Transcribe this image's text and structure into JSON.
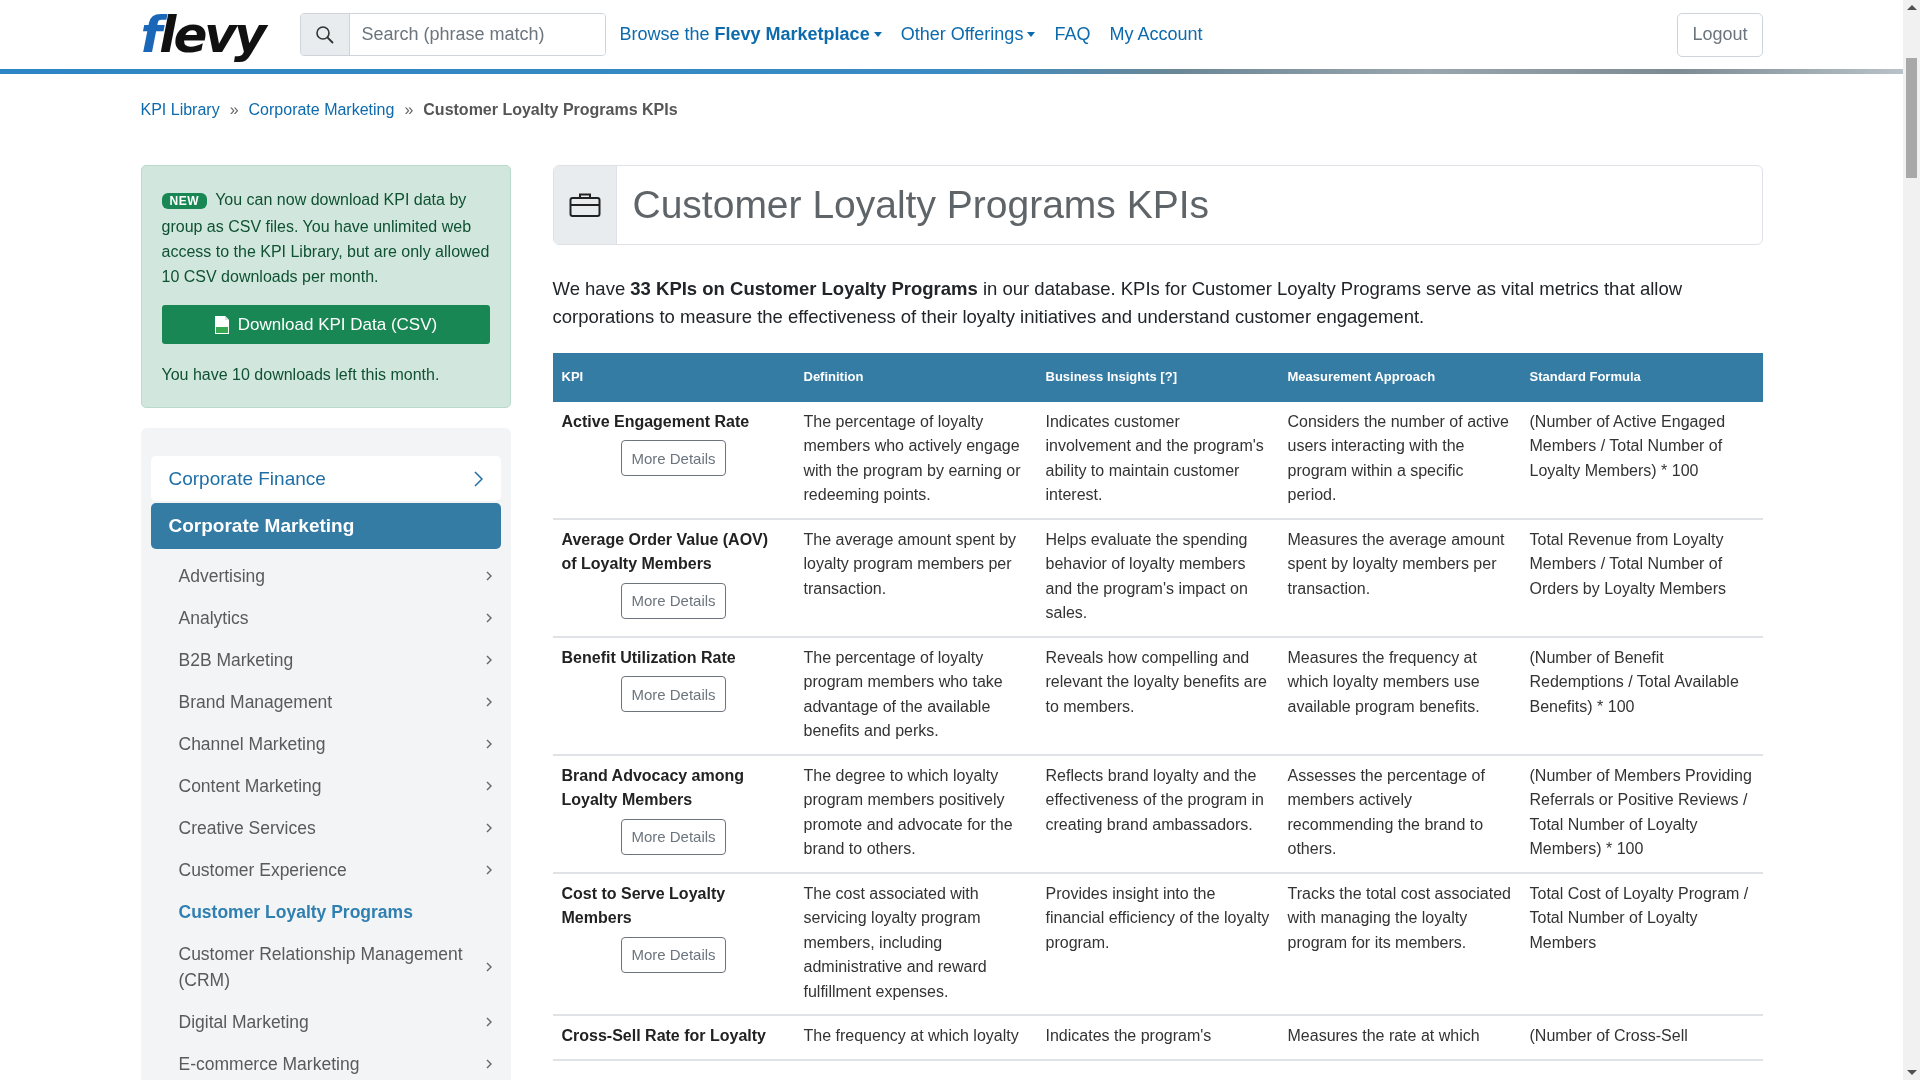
{
  "header": {
    "logo": "flevy",
    "search": {
      "placeholder": "Search (phrase match)"
    },
    "nav": [
      {
        "text": "Browse the **Flevy Marketplace**",
        "dropdown": true
      },
      {
        "text": "Other Offerings",
        "dropdown": true
      },
      {
        "text": "FAQ",
        "dropdown": false
      },
      {
        "text": "My Account",
        "dropdown": false
      }
    ],
    "logout": "Logout"
  },
  "breadcrumb": [
    {
      "label": "KPI Library",
      "current": false
    },
    {
      "label": "Corporate Marketing",
      "current": false
    },
    {
      "label": "Customer Loyalty Programs KPIs",
      "current": true
    }
  ],
  "breadcrumb_separator": "»",
  "notice": {
    "badge": "NEW",
    "text": "You can now download KPI data by group as CSV files. You have unlimited web access to the KPI Library, but are only allowed 10 CSV downloads per month.",
    "button": "Download KPI Data (CSV)",
    "footer": "You have 10 downloads left this month."
  },
  "sidebar": {
    "groups": [
      {
        "label": "Corporate Finance",
        "expanded": false
      },
      {
        "label": "Corporate Marketing",
        "expanded": true,
        "children": [
          {
            "label": "Advertising",
            "selected": false,
            "expandable": true
          },
          {
            "label": "Analytics",
            "selected": false,
            "expandable": true
          },
          {
            "label": "B2B Marketing",
            "selected": false,
            "expandable": true
          },
          {
            "label": "Brand Management",
            "selected": false,
            "expandable": true
          },
          {
            "label": "Channel Marketing",
            "selected": false,
            "expandable": true
          },
          {
            "label": "Content Marketing",
            "selected": false,
            "expandable": true
          },
          {
            "label": "Creative Services",
            "selected": false,
            "expandable": true
          },
          {
            "label": "Customer Experience",
            "selected": false,
            "expandable": true
          },
          {
            "label": "Customer Loyalty Programs",
            "selected": true,
            "expandable": false
          },
          {
            "label": "Customer Relationship Management (CRM)",
            "selected": false,
            "expandable": true
          },
          {
            "label": "Digital Marketing",
            "selected": false,
            "expandable": true
          },
          {
            "label": "E-commerce Marketing",
            "selected": false,
            "expandable": true
          }
        ]
      }
    ]
  },
  "main": {
    "title": "Customer Loyalty Programs KPIs",
    "intro": "We have **33 KPIs on Customer Loyalty Programs** in our database. KPIs for Customer Loyalty Programs serve as vital metrics that allow corporations to measure the effectiveness of their loyalty initiatives and understand customer engagement.",
    "table": {
      "columns": [
        "KPI",
        "Definition",
        "Business Insights [?]",
        "Measurement Approach",
        "Standard Formula"
      ],
      "rows": [
        {
          "button": "More Details",
          "cells": [
            "Active Engagement Rate",
            "The percentage of loyalty members who actively engage with the program by earning or redeeming points.",
            "Indicates customer involvement and the program's ability to maintain customer interest.",
            "Considers the number of active users interacting with the program within a specific period.",
            "(Number of Active Engaged Members / Total Number of Loyalty Members) * 100"
          ]
        },
        {
          "button": "More Details",
          "cells": [
            "Average Order Value (AOV) of Loyalty Members",
            "The average amount spent by loyalty program members per transaction.",
            "Helps evaluate the spending behavior of loyalty members and the program's impact on sales.",
            "Measures the average amount spent by loyalty members per transaction.",
            "Total Revenue from Loyalty Members / Total Number of Orders by Loyalty Members"
          ]
        },
        {
          "button": "More Details",
          "cells": [
            "Benefit Utilization Rate",
            "The percentage of loyalty program members who take advantage of the available benefits and perks.",
            "Reveals how compelling and relevant the loyalty benefits are to members.",
            "Measures the frequency at which loyalty members use available program benefits.",
            "(Number of Benefit Redemptions / Total Available Benefits) * 100"
          ]
        },
        {
          "button": "More Details",
          "cells": [
            "Brand Advocacy among Loyalty Members",
            "The degree to which loyalty program members positively promote and advocate for the brand to others.",
            "Reflects brand loyalty and the effectiveness of the program in creating brand ambassadors.",
            "Assesses the percentage of members actively recommending the brand to others.",
            "(Number of Members Providing Referrals or Positive Reviews / Total Number of Loyalty Members) * 100"
          ]
        },
        {
          "button": "More Details",
          "cells": [
            "Cost to Serve Loyalty Members",
            "The cost associated with servicing loyalty program members, including administrative and reward fulfillment expenses.",
            "Provides insight into the financial efficiency of the loyalty program.",
            "Tracks the total cost associated with managing the loyalty program for its members.",
            "Total Cost of Loyalty Program / Total Number of Loyalty Members"
          ]
        },
        {
          "cells": [
            "Cross-Sell Rate for Loyalty",
            "The frequency at which loyalty",
            "Indicates the program's",
            "Measures the rate at which",
            "(Number of Cross-Sell"
          ]
        }
      ]
    }
  }
}
